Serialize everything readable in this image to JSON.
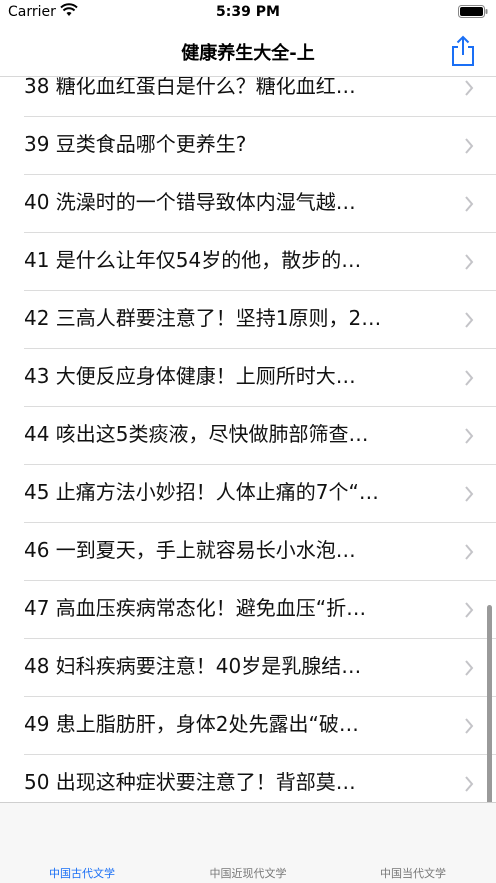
{
  "status": {
    "carrier": "Carrier",
    "time": "5:39 PM"
  },
  "nav": {
    "title": "健康养生大全-上",
    "share_icon": "share-icon"
  },
  "list_items": [
    "38 糖化血红蛋白是什么？糖化血红…",
    "39 豆类食品哪个更养生?",
    "40 洗澡时的一个错导致体内湿气越…",
    "41 是什么让年仅54岁的他，散步的…",
    "42 三高人群要注意了！坚持1原则，2…",
    "43 大便反应身体健康！上厕所时大…",
    "44 咳出这5类痰液，尽快做肺部筛查…",
    "45 止痛方法小妙招！人体止痛的7个“…",
    "46 一到夏天，手上就容易长小水泡…",
    "47 高血压疾病常态化！避免血压“折…",
    "48 妇科疾病要注意！40岁是乳腺结…",
    "49 患上脂肪肝，身体2处先露出“破…",
    "50 出现这种症状要注意了！背部莫…"
  ],
  "tabs": [
    {
      "label": "中国古代文学",
      "active": true
    },
    {
      "label": "中国近现代文学",
      "active": false
    },
    {
      "label": "中国当代文学",
      "active": false
    }
  ],
  "colors": {
    "accent": "#1a6ff5",
    "chevron": "#c4c4c8"
  }
}
